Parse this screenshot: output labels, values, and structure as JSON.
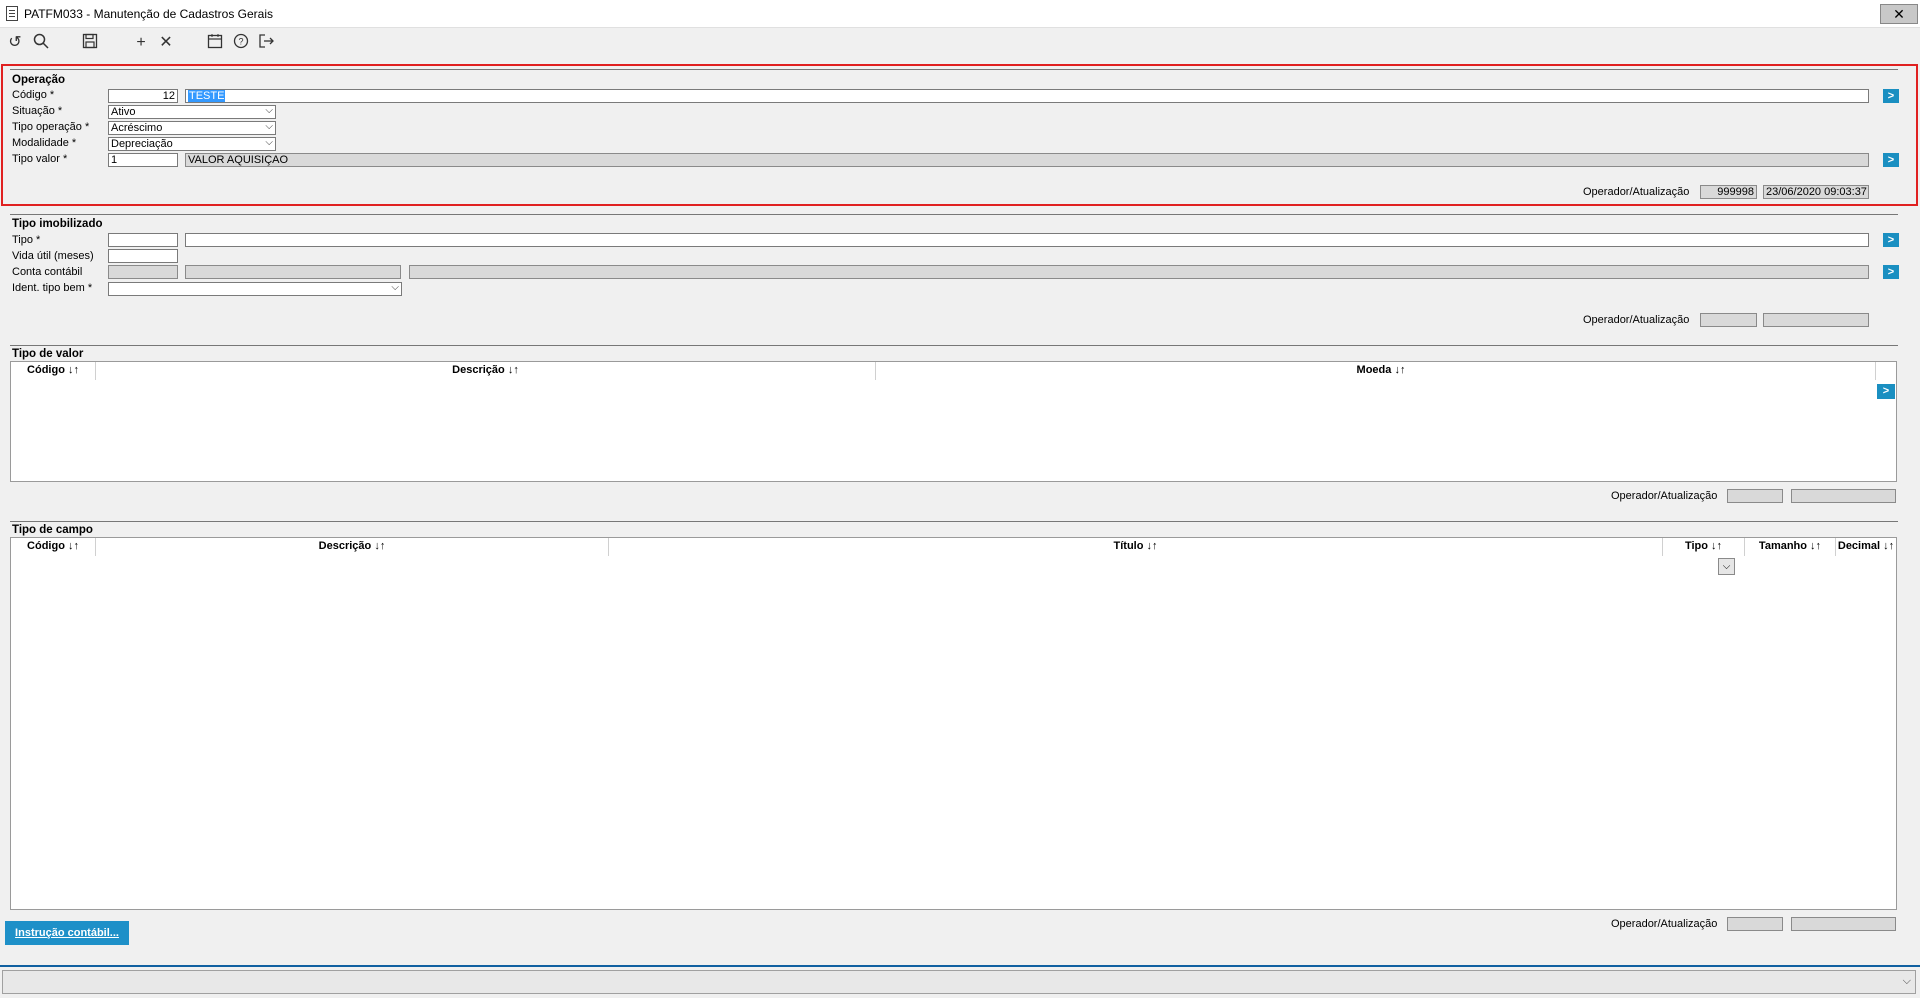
{
  "window": {
    "title": "PATFM033 - Manutenção de Cadastros Gerais",
    "close_glyph": "✕"
  },
  "toolbar": {
    "icons": [
      "refresh-icon",
      "search-icon",
      "save-icon",
      "add-icon",
      "delete-icon",
      "calendar-icon",
      "help-icon",
      "exit-icon"
    ]
  },
  "operacao": {
    "title": "Operação",
    "codigo_label": "Código *",
    "codigo_value": "12",
    "codigo_desc": "TESTE",
    "situacao_label": "Situação *",
    "situacao_value": "Ativo",
    "tipo_operacao_label": "Tipo operação *",
    "tipo_operacao_value": "Acréscimo",
    "modalidade_label": "Modalidade *",
    "modalidade_value": "Depreciação",
    "tipo_valor_label": "Tipo valor *",
    "tipo_valor_value": "1",
    "tipo_valor_desc": "VALOR AQUISIÇAO",
    "operador_label": "Operador/Atualização",
    "operador_value": "999998",
    "atualizacao_value": "23/06/2020 09:03:37"
  },
  "tipo_imobilizado": {
    "title": "Tipo imobilizado",
    "tipo_label": "Tipo *",
    "vida_util_label": "Vida útil (meses)",
    "conta_contabil_label": "Conta contábil",
    "ident_tipo_bem_label": "Ident. tipo bem *",
    "operador_label": "Operador/Atualização"
  },
  "tipo_valor": {
    "title": "Tipo de valor",
    "columns": [
      "Código ↓↑",
      "Descrição ↓↑",
      "Moeda ↓↑"
    ],
    "operador_label": "Operador/Atualização"
  },
  "tipo_campo": {
    "title": "Tipo de campo",
    "columns": [
      "Código ↓↑",
      "Descrição ↓↑",
      "Título ↓↑",
      "Tipo ↓↑",
      "Tamanho ↓↑",
      "Decimal ↓↑"
    ],
    "operador_label": "Operador/Atualização"
  },
  "buttons": {
    "instrucao_contabil": "Instrução contábil...",
    "go_glyph": ">"
  }
}
